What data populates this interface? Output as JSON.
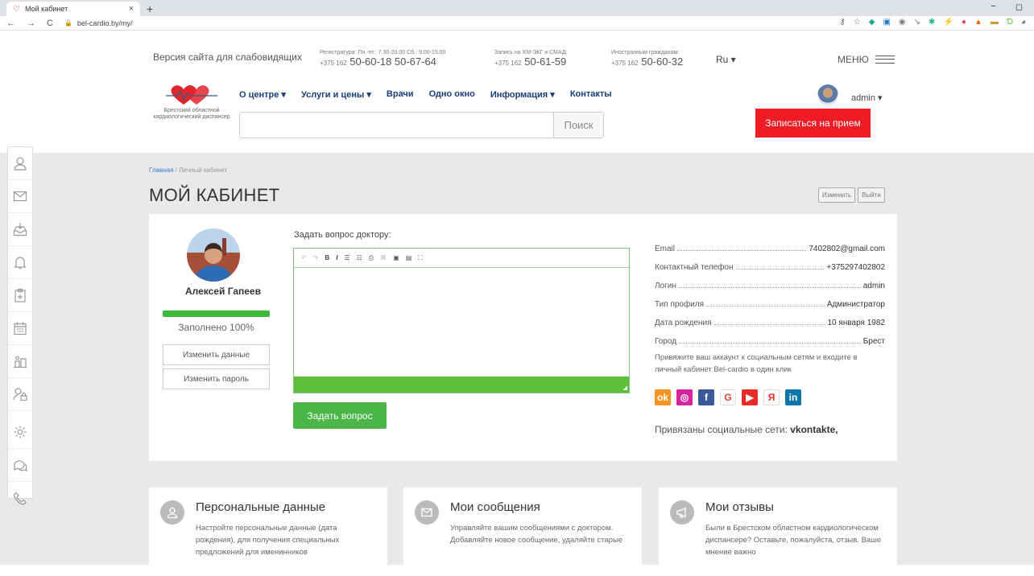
{
  "browser": {
    "tab_title": "Мой кабинет",
    "tab_close": "×",
    "new_tab": "+",
    "url": "bel-cardio.by/my/",
    "win_min": "−",
    "win_max": "◻"
  },
  "header": {
    "low_vision": "Версия сайта для слабовидящих",
    "registry": {
      "label": "Регистратура: Пн.-пт.: 7.30-20.00 Сб.: 9.00-15.00",
      "code": "+375 162",
      "numbers": "50-60-18  50-67-64"
    },
    "ecg": {
      "label": "Запись на ХМ-ЭКГ и СМАД:",
      "code": "+375 162",
      "numbers": "50-61-59"
    },
    "foreign": {
      "label": "Иностранным гражданам:",
      "code": "+375 162",
      "numbers": "50-60-32"
    },
    "lang": "Ru ▾",
    "menu": "МЕНЮ",
    "logo_text": "Брестский областной кардиологический диспансер",
    "nav": [
      "О центре ▾",
      "Услуги и цены ▾",
      "Врачи",
      "Одно окно",
      "Информация ▾",
      "Контакты"
    ],
    "user": "admin ▾",
    "search_button": "Поиск",
    "search_placeholder": "",
    "book_button": "Записаться на прием"
  },
  "breadcrumb": {
    "home": "Главная",
    "sep": " / ",
    "current": "Личный кабинет"
  },
  "page_title": "МОЙ КАБИНЕТ",
  "page_buttons": {
    "edit": "Изменить",
    "logout": "Выйти"
  },
  "profile": {
    "name": "Алексей Гапеев",
    "completion_percent": 100,
    "completion_text": "Заполнено 100%",
    "edit_data": "Изменить данные",
    "change_password": "Изменить пароль"
  },
  "question": {
    "label": "Задать вопрос доктору:",
    "submit": "Задать вопрос",
    "toolbar": [
      "↶",
      "↷",
      "B",
      "I",
      "☰",
      "☷",
      "⎙",
      "⌘",
      "▣",
      "▤",
      "⛶"
    ]
  },
  "info": [
    {
      "k": "Email",
      "v": "7402802@gmail.com"
    },
    {
      "k": "Контактный телефон",
      "v": "+375297402802"
    },
    {
      "k": "Логин",
      "v": "admin"
    },
    {
      "k": "Тип профиля",
      "v": "Администратор"
    },
    {
      "k": "Дата рождения",
      "v": "10 января 1982"
    },
    {
      "k": "Город",
      "v": "Брест"
    }
  ],
  "social": {
    "note": "Привяжите ваш аккаунт к социальным сетям и входите в личный кабинет Bel-cardio в один клик",
    "icons": [
      {
        "name": "odnoklassniki",
        "glyph": "ok",
        "color": "#f7931e"
      },
      {
        "name": "instagram",
        "glyph": "◎",
        "color": "#d6249f"
      },
      {
        "name": "facebook",
        "glyph": "f",
        "color": "#3b5998"
      },
      {
        "name": "google",
        "glyph": "G",
        "color": "#ffffff"
      },
      {
        "name": "youtube",
        "glyph": "▶",
        "color": "#e52d27"
      },
      {
        "name": "yandex",
        "glyph": "Я",
        "color": "#ffffff"
      },
      {
        "name": "linkedin",
        "glyph": "in",
        "color": "#0e76a8"
      }
    ],
    "linked_label": "Привязаны социальные сети:",
    "linked_value": "vkontakte,"
  },
  "tiles": [
    {
      "title": "Персональные данные",
      "icon": "user-icon",
      "desc": "Настройте персональные данные (дата рождения), для получения специальных предложений для именинников"
    },
    {
      "title": "Мои сообщения",
      "icon": "envelope-icon",
      "desc": "Управляйте вашим сообщениями с доктором. Добавляйте новое сообщение, удаляйте старые"
    },
    {
      "title": "Мои отзывы",
      "icon": "megaphone-icon",
      "desc": "Были в Брестском областном кардиологическом диспансере? Оставьте, пожалуйста, отзыв. Ваше мнение важно"
    }
  ],
  "sidebar_icons": [
    "user-icon",
    "envelope-icon",
    "inbox-icon",
    "bell-icon",
    "medical-clipboard-icon",
    "calendar-icon",
    "tracking-icon",
    "user-lock-icon",
    "gear-icon",
    "chat-icon",
    "phone-icon"
  ],
  "colors": {
    "accent_red": "#ee1c25",
    "green": "#4cb54a",
    "nav_blue": "#1a3c7a"
  }
}
